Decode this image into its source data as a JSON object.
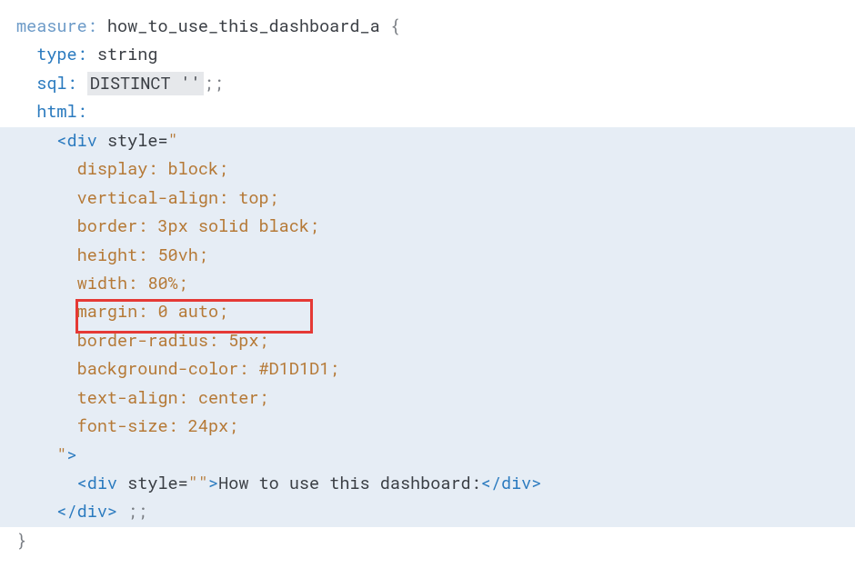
{
  "code": {
    "line1": {
      "measure_kw": "measure:",
      "name": " how_to_use_this_dashboard_a ",
      "brace": "{"
    },
    "line2": {
      "indent": "  ",
      "type_kw": "type:",
      "val": " string"
    },
    "line3": {
      "indent": "  ",
      "sql_kw": "sql:",
      "space": " ",
      "distinct": "DISTINCT ''",
      "term": ";;"
    },
    "line4": {
      "indent": "  ",
      "html_kw": "html:"
    },
    "line5": {
      "indent": "    ",
      "open": "<div",
      "attr": " style",
      "eq": "=",
      "quote": "\""
    },
    "line6": {
      "indent": "      ",
      "css": "display: block;"
    },
    "line7": {
      "indent": "      ",
      "css": "vertical-align: top;"
    },
    "line8": {
      "indent": "      ",
      "css": "border: 3px solid black;"
    },
    "line9": {
      "indent": "      ",
      "css": "height: 50vh;"
    },
    "line10": {
      "indent": "      ",
      "css": "width: 80%;"
    },
    "line11": {
      "indent": "      ",
      "css": "margin: 0 auto;"
    },
    "line12": {
      "indent": "      ",
      "css": "border-radius: 5px;"
    },
    "line13": {
      "indent": "      ",
      "css": "background-color: #D1D1D1;"
    },
    "line14": {
      "indent": "      ",
      "css": "text-align: center;"
    },
    "line15": {
      "indent": "      ",
      "css": "font-size: 24px;"
    },
    "line16": {
      "indent": "    ",
      "quote": "\"",
      "close": ">"
    },
    "line17": {
      "indent": "      ",
      "open": "<div",
      "attr": " style",
      "eq": "=",
      "q1": "\"",
      "q2": "\"",
      "gt": ">",
      "text": "How to use this dashboard:",
      "closetag": "</div>"
    },
    "line18": {
      "indent": "    ",
      "closetag": "</div>",
      "term": " ;;"
    },
    "line19": {
      "brace": "}"
    }
  }
}
